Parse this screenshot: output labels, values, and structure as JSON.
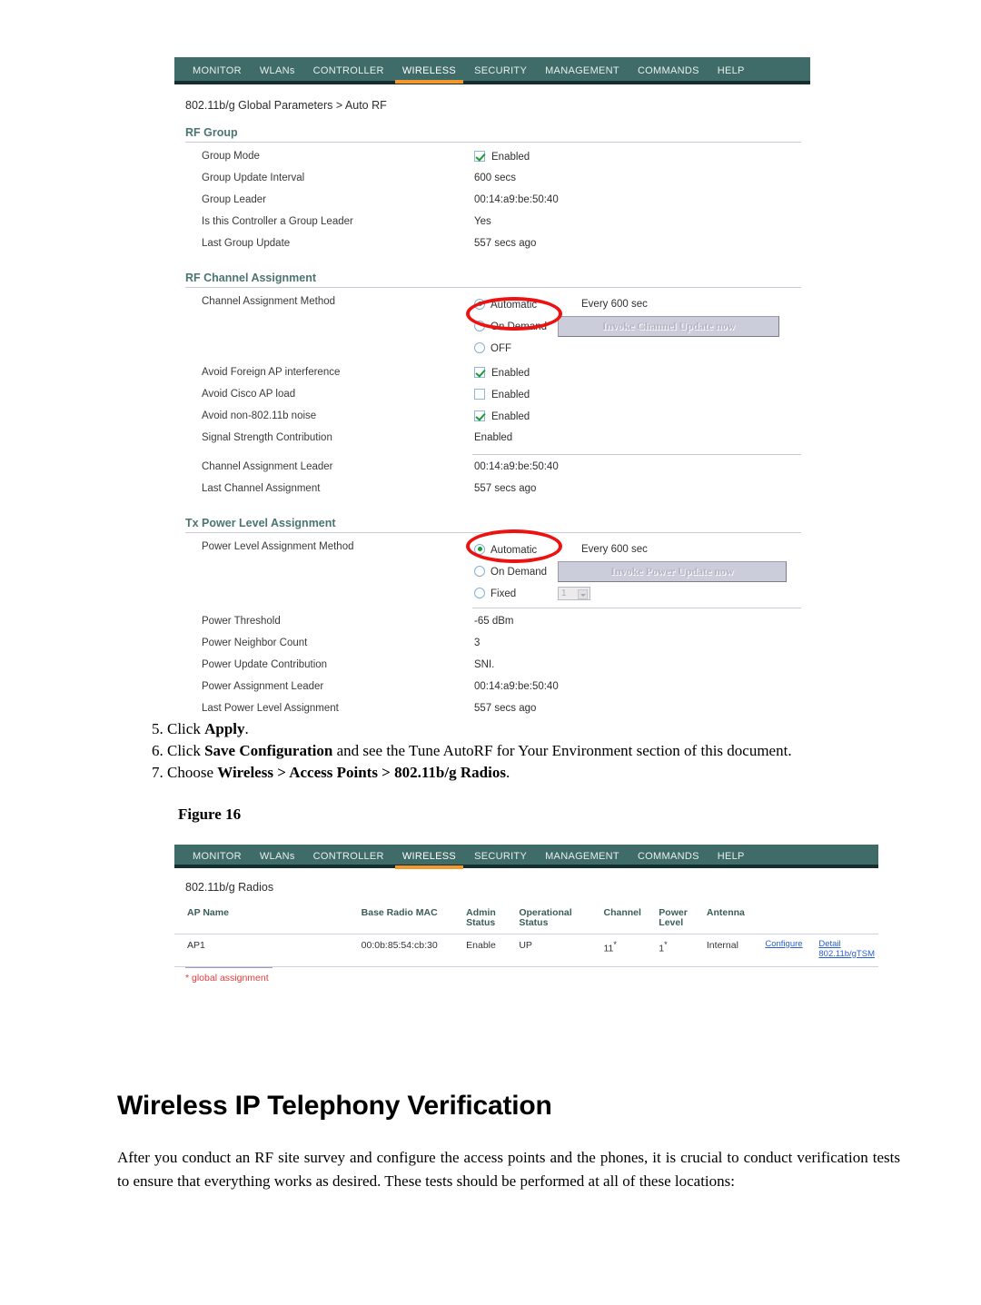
{
  "figure1": {
    "nav": {
      "items": [
        "MONITOR",
        "WLANs",
        "CONTROLLER",
        "WIRELESS",
        "SECURITY",
        "MANAGEMENT",
        "COMMANDS",
        "HELP"
      ],
      "active": "WIRELESS"
    },
    "breadcrumb": "802.11b/g Global Parameters > Auto RF",
    "sections": {
      "rf_group": {
        "title": "RF Group",
        "rows": [
          {
            "label": "Group Mode",
            "value": "Enabled",
            "control": "checkbox-checked"
          },
          {
            "label": "Group Update Interval",
            "value": "600 secs"
          },
          {
            "label": "Group Leader",
            "value": "00:14:a9:be:50:40"
          },
          {
            "label": "Is this Controller a Group Leader",
            "value": "Yes"
          },
          {
            "label": "Last Group Update",
            "value": "557 secs ago"
          }
        ]
      },
      "rf_channel": {
        "title": "RF Channel Assignment",
        "method_label": "Channel Assignment Method",
        "options": [
          {
            "label": "Automatic",
            "selected": true,
            "note": "Every 600 sec"
          },
          {
            "label": "On Demand",
            "selected": false,
            "button": "Invoke Channel Update now"
          },
          {
            "label": "OFF",
            "selected": false
          }
        ],
        "rows": [
          {
            "label": "Avoid Foreign AP interference",
            "value": "Enabled",
            "control": "checkbox-checked"
          },
          {
            "label": "Avoid Cisco AP load",
            "value": "Enabled",
            "control": "checkbox-unchecked"
          },
          {
            "label": "Avoid non-802.11b noise",
            "value": "Enabled",
            "control": "checkbox-checked"
          },
          {
            "label": "Signal Strength Contribution",
            "value": "Enabled"
          },
          {
            "label": "Channel Assignment Leader",
            "value": "00:14:a9:be:50:40"
          },
          {
            "label": "Last Channel Assignment",
            "value": "557 secs ago"
          }
        ]
      },
      "tx_power": {
        "title": "Tx Power Level Assignment",
        "method_label": "Power Level Assignment Method",
        "options": [
          {
            "label": "Automatic",
            "selected": true,
            "note": "Every 600 sec"
          },
          {
            "label": "On Demand",
            "selected": false,
            "button": "Invoke Power Update now"
          },
          {
            "label": "Fixed",
            "selected": false,
            "select_value": "1"
          }
        ],
        "rows": [
          {
            "label": "Power Threshold",
            "value": "-65 dBm"
          },
          {
            "label": "Power Neighbor Count",
            "value": "3"
          },
          {
            "label": "Power Update Contribution",
            "value": "SNI."
          },
          {
            "label": "Power Assignment Leader",
            "value": "00:14:a9:be:50:40"
          },
          {
            "label": "Last Power Level Assignment",
            "value": "557 secs ago"
          }
        ]
      }
    }
  },
  "steps": {
    "item5_prefix": "5. Click ",
    "item5_bold": "Apply",
    "item5_suffix": ".",
    "item6_prefix": "6. Click ",
    "item6_bold": "Save Configuration",
    "item6_suffix": " and see the Tune AutoRF for Your Environment section of this document.",
    "item7_prefix": "7. Choose ",
    "item7_bold": "Wireless > Access Points > 802.11b/g Radios",
    "item7_suffix": "."
  },
  "figure_caption": "Figure 16",
  "figure2": {
    "nav": {
      "items": [
        "MONITOR",
        "WLANs",
        "CONTROLLER",
        "WIRELESS",
        "SECURITY",
        "MANAGEMENT",
        "COMMANDS",
        "HELP"
      ],
      "active": "WIRELESS"
    },
    "title": "802.11b/g Radios",
    "table": {
      "headers": [
        "AP Name",
        "Base Radio MAC",
        "Admin Status",
        "Operational Status",
        "Channel",
        "Power Level",
        "Antenna",
        "",
        ""
      ],
      "rows": [
        {
          "ap_name": "AP1",
          "base_radio_mac": "00:0b:85:54:cb:30",
          "admin_status": "Enable",
          "operational_status": "UP",
          "channel": "11",
          "channel_sup": "*",
          "power_level": "1",
          "power_sup": "*",
          "antenna": "Internal",
          "link_configure": "Configure",
          "link_detail": "Detail",
          "link_tsm": "802.11b/gTSM"
        }
      ]
    },
    "footnote": "* global assignment"
  },
  "heading": "Wireless IP Telephony Verification",
  "paragraph": "After you conduct an RF site survey and configure the access points and the phones, it is crucial to conduct verification tests to ensure that everything works as desired. These tests should be performed at all of these locations:",
  "colors": {
    "nav_bg": "#3f6b68",
    "nav_underline": "#13302e",
    "nav_active": "#f2982c",
    "section_title": "#4a7572",
    "link": "#2a5fcf",
    "annotation": "#ee1111",
    "footnote": "#e33b3b",
    "check": "#1a9c2e"
  }
}
